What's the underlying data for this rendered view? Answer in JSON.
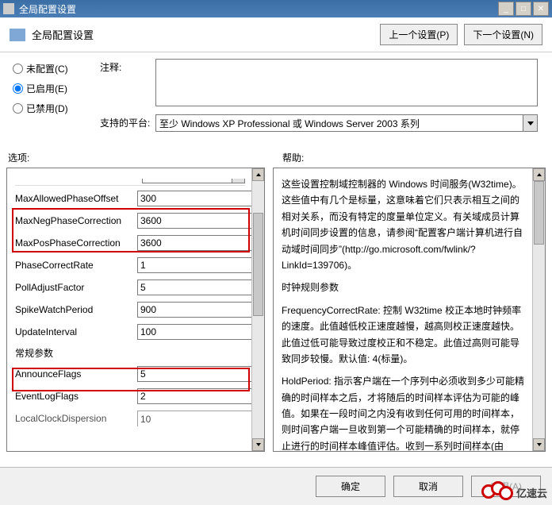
{
  "window": {
    "title": "全局配置设置"
  },
  "header": {
    "subtitle": "全局配置设置",
    "prev_btn": "上一个设置(P)",
    "next_btn": "下一个设置(N)"
  },
  "config": {
    "radio_unconfigured": "未配置(C)",
    "radio_enabled": "已启用(E)",
    "radio_disabled": "已禁用(D)",
    "selected": "enabled",
    "comment_label": "注释:",
    "comment_value": "",
    "platform_label": "支持的平台:",
    "platform_value": "至少 Windows XP Professional 或 Windows Server 2003 系列"
  },
  "columns": {
    "options_label": "选项:",
    "help_label": "帮助:"
  },
  "options": {
    "params": [
      {
        "name": "MaxAllowedPhaseOffset",
        "value": "300"
      },
      {
        "name": "MaxNegPhaseCorrection",
        "value": "3600"
      },
      {
        "name": "MaxPosPhaseCorrection",
        "value": "3600"
      },
      {
        "name": "PhaseCorrectRate",
        "value": "1"
      },
      {
        "name": "PollAdjustFactor",
        "value": "5"
      },
      {
        "name": "SpikeWatchPeriod",
        "value": "900"
      },
      {
        "name": "UpdateInterval",
        "value": "100"
      }
    ],
    "general_section_label": "常规参数",
    "general": [
      {
        "name": "AnnounceFlags",
        "value": "5"
      },
      {
        "name": "EventLogFlags",
        "value": "2"
      }
    ],
    "cutoff_label": "LocalClockDispersion",
    "cutoff_val": "10"
  },
  "help": {
    "p1": "这些设置控制域控制器的 Windows 时间服务(W32time)。这些值中有几个是标量，这意味着它们只表示相互之间的相对关系，而没有特定的度量单位定义。有关域成员计算机时间同步设置的信息，请参阅“配置客户端计算机进行自动域时间同步”(http://go.microsoft.com/fwlink/?LinkId=139706)。",
    "h_clock": "时钟规则参数",
    "p2": "FrequencyCorrectRate: 控制 W32time 校正本地时钟频率的速度。此值越低校正速度越慢，越高则校正速度越快。此值过低可能导致过度校正和不稳定。此值过高则可能导致同步较慢。默认值: 4(标量)。",
    "p3": "HoldPeriod: 指示客户端在一个序列中必须收到多少可能精确的时间样本之后，才将随后的时间样本评估为可能的峰值。如果在一段时间之内没有收到任何可用的时间样本，则时间客户端一旦收到第一个可能精确的时间样本，就停止进行的时间样本峰值评估。收到一系列时间样本(由 HoldPeriod 指定)之后，时间客户端将对后续时间样本进行峰值评估。当某时间样本与客户端本地时钟之间的时间"
  },
  "footer": {
    "ok": "确定",
    "cancel": "取消",
    "apply": "应用(A)"
  },
  "watermark": {
    "text": "亿速云"
  },
  "colors": {
    "accent": "#d00000"
  }
}
